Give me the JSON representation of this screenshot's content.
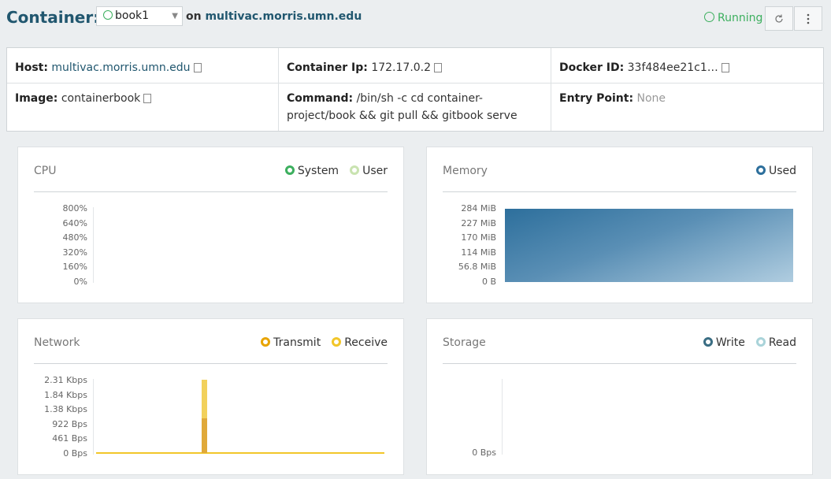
{
  "header": {
    "title": "Container:",
    "container_select": "book1",
    "on_label": "on",
    "host": "multivac.morris.umn.edu",
    "status": "Running"
  },
  "info": {
    "host_label": "Host:",
    "host_value": "multivac.morris.umn.edu",
    "ip_label": "Container Ip:",
    "ip_value": "172.17.0.2",
    "docker_label": "Docker ID:",
    "docker_value": "33f484ee21c1…",
    "image_label": "Image:",
    "image_value": "containerbook",
    "command_label": "Command:",
    "command_value": "/bin/sh -c cd container-project/book && git pull && gitbook serve",
    "entry_label": "Entry Point:",
    "entry_value": "None"
  },
  "panels": {
    "cpu": {
      "title": "CPU",
      "legend": [
        "System",
        "User"
      ],
      "ticks": [
        "800%",
        "640%",
        "480%",
        "320%",
        "160%",
        "0%"
      ]
    },
    "memory": {
      "title": "Memory",
      "legend": [
        "Used"
      ],
      "ticks": [
        "284 MiB",
        "227 MiB",
        "170 MiB",
        "114 MiB",
        "56.8 MiB",
        "0 B"
      ]
    },
    "network": {
      "title": "Network",
      "legend": [
        "Transmit",
        "Receive"
      ],
      "ticks": [
        "2.31 Kbps",
        "1.84 Kbps",
        "1.38 Kbps",
        "922 Bps",
        "461 Bps",
        "0 Bps"
      ]
    },
    "storage": {
      "title": "Storage",
      "legend": [
        "Write",
        "Read"
      ],
      "ticks": [
        "0 Bps"
      ]
    }
  },
  "colors": {
    "accent": "#21576f",
    "running": "#3caf5e",
    "cpu_system": "#3caf5e",
    "cpu_user": "#c9e3b0",
    "memory_used": "#2d6f9c",
    "net_transmit": "#e8a400",
    "net_receive": "#f2c629",
    "storage_write": "#3a6d83",
    "storage_read": "#a9d3d9"
  }
}
